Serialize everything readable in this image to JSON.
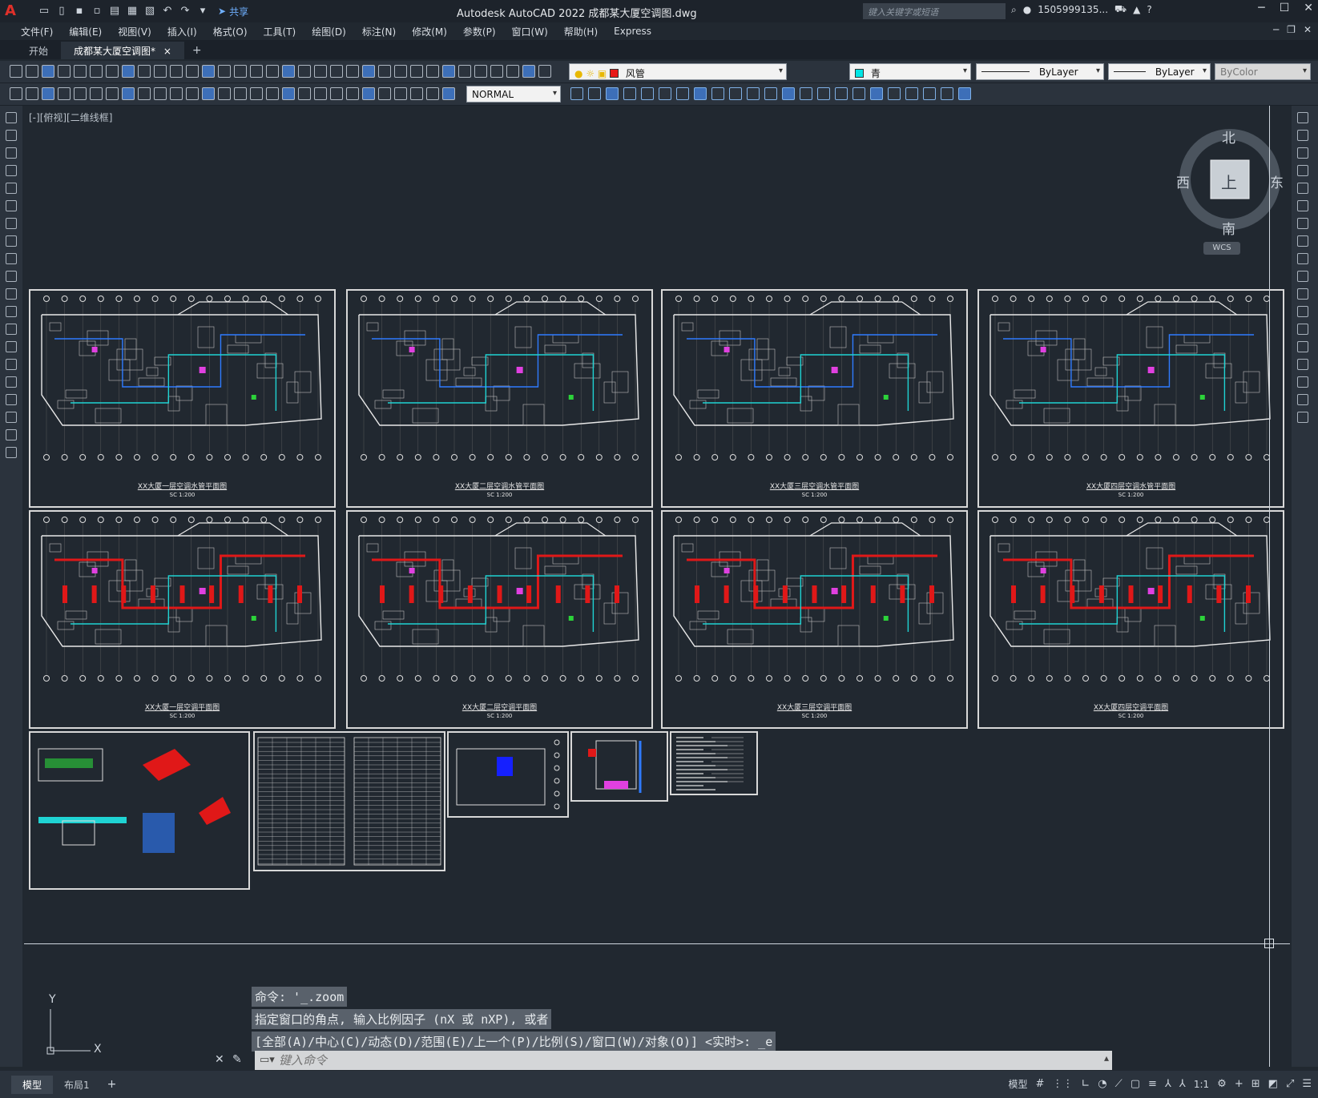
{
  "titlebar": {
    "app_title": "Autodesk AutoCAD 2022    成都某大厦空调图.dwg",
    "share_label": "共享",
    "search_placeholder": "键入关键字或短语",
    "user_name": "1505999135...",
    "logo_letter": "A"
  },
  "menu": [
    "文件(F)",
    "编辑(E)",
    "视图(V)",
    "插入(I)",
    "格式(O)",
    "工具(T)",
    "绘图(D)",
    "标注(N)",
    "修改(M)",
    "参数(P)",
    "窗口(W)",
    "帮助(H)",
    "Express"
  ],
  "tabs": {
    "start": "开始",
    "document": "成都某大厦空调图*",
    "close_glyph": "×",
    "plus_glyph": "+"
  },
  "properties": {
    "layer_name": "风管",
    "layer_color": "#e81818",
    "color_name": "青",
    "color_swatch": "#00e5e5",
    "linetype": "ByLayer",
    "lineweight": "ByLayer",
    "plotstyle": "ByColor",
    "dimstyle": "NORMAL"
  },
  "viewport": {
    "label": "[-][俯视][二维线框]",
    "viewcube": {
      "north": "北",
      "south": "南",
      "east": "东",
      "west": "西",
      "top": "上"
    },
    "wcs_label": "WCS"
  },
  "sheets_top": [
    {
      "title": "XX大厦一层空调水管平面图",
      "scale": "SC   1:200"
    },
    {
      "title": "XX大厦二层空调水管平面图",
      "scale": "SC   1:200"
    },
    {
      "title": "XX大厦三层空调水管平面图",
      "scale": "SC   1:200"
    },
    {
      "title": "XX大厦四层空调水管平面图",
      "scale": "SC   1:200"
    }
  ],
  "sheets_bottom": [
    {
      "title": "XX大厦一层空调平面图",
      "scale": "SC   1:200"
    },
    {
      "title": "XX大厦二层空调平面图",
      "scale": "SC   1:200"
    },
    {
      "title": "XX大厦三层空调平面图",
      "scale": "SC   1:200"
    },
    {
      "title": "XX大厦四层空调平面图",
      "scale": "SC   1:200"
    }
  ],
  "command": {
    "history": [
      "命令: '_.zoom",
      "指定窗口的角点, 输入比例因子 (nX 或 nXP), 或者",
      "[全部(A)/中心(C)/动态(D)/范围(E)/上一个(P)/比例(S)/窗口(W)/对象(O)] <实时>: _e"
    ],
    "placeholder": "键入命令"
  },
  "ucs": {
    "x": "X",
    "y": "Y"
  },
  "status": {
    "layout_tabs": [
      "模型",
      "布局1"
    ],
    "model_label": "模型",
    "scale": "1:1"
  }
}
